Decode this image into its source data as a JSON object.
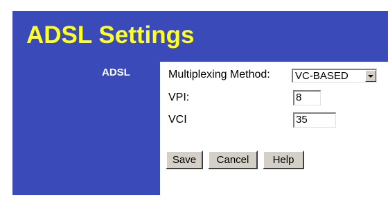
{
  "header": {
    "title": "ADSL Settings"
  },
  "sidebar": {
    "section_label": "ADSL"
  },
  "form": {
    "multiplexing_label": "Multiplexing Method:",
    "multiplexing_value": "VC-BASED",
    "vpi_label": "VPI:",
    "vpi_value": "8",
    "vci_label": "VCI",
    "vci_value": "35"
  },
  "buttons": {
    "save": "Save",
    "cancel": "Cancel",
    "help": "Help"
  },
  "colors": {
    "panel": "#3a4ab8",
    "title": "#ffff22",
    "content_bg": "#ffffff"
  }
}
